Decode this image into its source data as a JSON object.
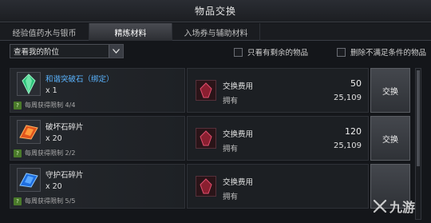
{
  "window": {
    "title": "物品交换"
  },
  "tabs": [
    {
      "label": "经验值药水与银币"
    },
    {
      "label": "精炼材料"
    },
    {
      "label": "入场券与辅助材料"
    }
  ],
  "filter": {
    "selected": "查看我的阶位"
  },
  "checks": [
    {
      "label": "只看有剩余的物品",
      "checked": false
    },
    {
      "label": "删除不满足条件的物品",
      "checked": false
    }
  ],
  "items": [
    {
      "name": "和谐突破石（绑定）",
      "qty": "x 1",
      "limit": "每周获得限制 4/4",
      "cost_label": "交换费用",
      "cost": "50",
      "own_label": "拥有",
      "own": "25,109",
      "button": "交换",
      "color": "#5ab4ff"
    },
    {
      "name": "破坏石碎片",
      "qty": "x 20",
      "limit": "每周获得限制 2/2",
      "cost_label": "交换费用",
      "cost": "120",
      "own_label": "拥有",
      "own": "25,109",
      "button": "交换",
      "color": "#e8e8e8"
    },
    {
      "name": "守护石碎片",
      "qty": "x 20",
      "limit": "每周获得限制 5/5",
      "cost_label": "交换费用",
      "cost": "",
      "own_label": "拥有",
      "own": "",
      "button": "",
      "color": "#e8e8e8"
    }
  ],
  "icons": {
    "dropdown": "chevron-down-icon",
    "item_0": "green-crystal-icon",
    "item_1": "red-shard-icon",
    "item_2": "blue-shard-icon",
    "cost": "red-crystal-icon",
    "help": "question-icon"
  },
  "watermark": {
    "text": "九游"
  }
}
